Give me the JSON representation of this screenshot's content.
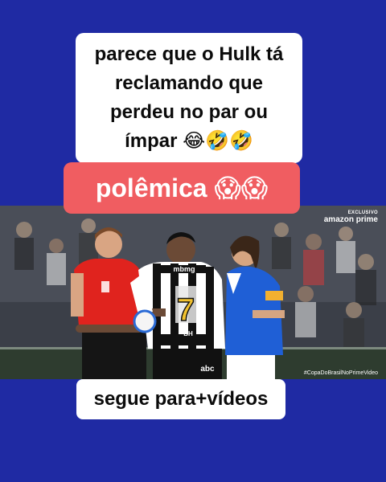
{
  "caption": {
    "lines": [
      "parece que o Hulk tá",
      "reclamando que",
      "perdeu no par ou",
      "ímpar 😂🤣🤣"
    ]
  },
  "tag": {
    "text": "polêmica 😱😱"
  },
  "video": {
    "badge_small": "EXCLUSIVO",
    "badge_main": "amazon prime",
    "hashtag": "#CopaDoBrasilNoPrimeVideo",
    "player_number": "7",
    "sponsor_top": "mbmg",
    "sponsor_bottom": "abc",
    "shorts_text": "BH"
  },
  "cta": {
    "text": "segue para+vídeos"
  },
  "colors": {
    "background": "#1f2aa3",
    "tag": "#f05d61",
    "referee_shirt": "#e0231e",
    "cruzeiro_blue": "#1f5fd6"
  }
}
